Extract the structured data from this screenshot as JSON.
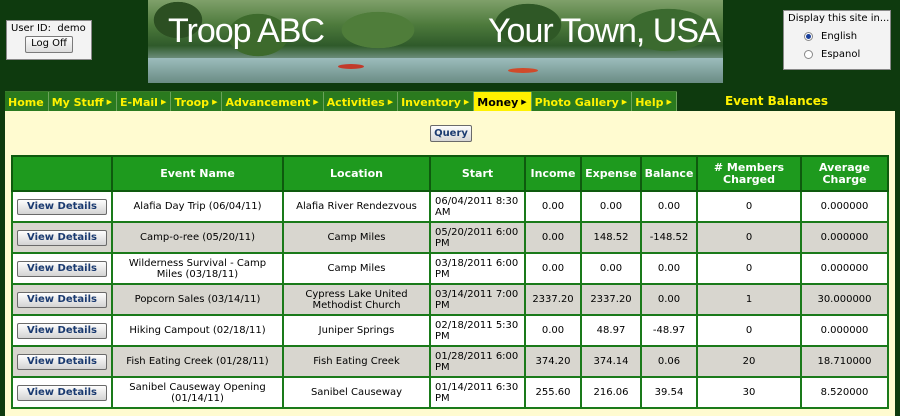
{
  "user": {
    "label": "User ID:",
    "id": "demo",
    "logoff": "Log Off"
  },
  "banner": {
    "title_left": "Troop ABC",
    "title_right": "Your Town, USA"
  },
  "language": {
    "title": "Display this site in...",
    "options": [
      {
        "label": "English",
        "selected": true
      },
      {
        "label": "Espanol",
        "selected": false
      }
    ]
  },
  "nav": {
    "items": [
      {
        "label": "Home",
        "arrow": false,
        "active": false
      },
      {
        "label": "My Stuff",
        "arrow": true,
        "active": false
      },
      {
        "label": "E-Mail",
        "arrow": true,
        "active": false
      },
      {
        "label": "Troop",
        "arrow": true,
        "active": false
      },
      {
        "label": "Advancement",
        "arrow": true,
        "active": false
      },
      {
        "label": "Activities",
        "arrow": true,
        "active": false
      },
      {
        "label": "Inventory",
        "arrow": true,
        "active": false
      },
      {
        "label": "Money",
        "arrow": true,
        "active": true
      },
      {
        "label": "Photo Gallery",
        "arrow": true,
        "active": false
      },
      {
        "label": "Help",
        "arrow": true,
        "active": false
      }
    ],
    "page_title": "Event Balances"
  },
  "query_label": "Query",
  "table": {
    "columns": [
      "",
      "Event Name",
      "Location",
      "Start",
      "Income",
      "Expense",
      "Balance",
      "# Members\nCharged",
      "Average\nCharge"
    ],
    "view_label": "View Details",
    "rows": [
      [
        "Alafia Day Trip (06/04/11)",
        "Alafia River Rendezvous",
        "06/04/2011 8:30 AM",
        "0.00",
        "0.00",
        "0.00",
        "0",
        "0.000000"
      ],
      [
        "Camp-o-ree (05/20/11)",
        "Camp Miles",
        "05/20/2011 6:00 PM",
        "0.00",
        "148.52",
        "-148.52",
        "0",
        "0.000000"
      ],
      [
        "Wilderness Survival - Camp Miles (03/18/11)",
        "Camp Miles",
        "03/18/2011 6:00 PM",
        "0.00",
        "0.00",
        "0.00",
        "0",
        "0.000000"
      ],
      [
        "Popcorn Sales (03/14/11)",
        "Cypress Lake United Methodist Church",
        "03/14/2011 7:00 PM",
        "2337.20",
        "2337.20",
        "0.00",
        "1",
        "30.000000"
      ],
      [
        "Hiking Campout (02/18/11)",
        "Juniper Springs",
        "02/18/2011 5:30 PM",
        "0.00",
        "48.97",
        "-48.97",
        "0",
        "0.000000"
      ],
      [
        "Fish Eating Creek (01/28/11)",
        "Fish Eating Creek",
        "01/28/2011 6:00 PM",
        "374.20",
        "374.14",
        "0.06",
        "20",
        "18.710000"
      ],
      [
        "Sanibel Causeway Opening (01/14/11)",
        "Sanibel Causeway",
        "01/14/2011 6:30 PM",
        "255.60",
        "216.06",
        "39.54",
        "30",
        "8.520000"
      ]
    ]
  }
}
